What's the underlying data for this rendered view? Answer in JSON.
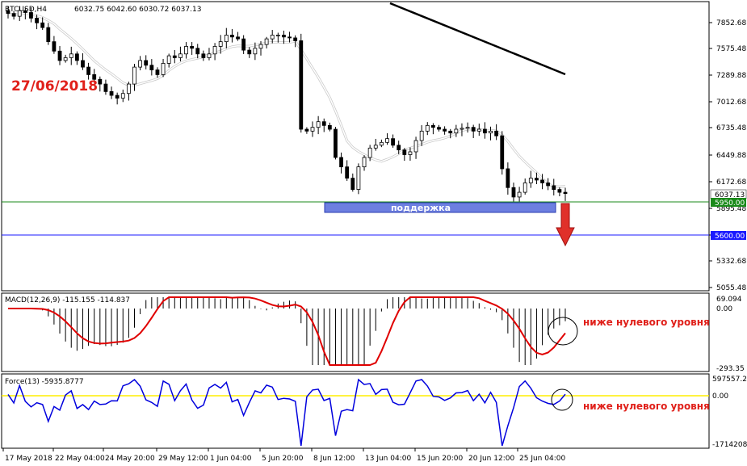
{
  "chart_data": [
    {
      "type": "candlestick",
      "symbol": "BTCUSD,H4",
      "ohlc_readout": "6032.75 6042.60 6030.72 6037.13",
      "date_label": "27/06/2018",
      "y_ticks": [
        "7852.68",
        "7575.48",
        "7289.88",
        "7012.68",
        "6735.48",
        "6449.88",
        "6172.68",
        "5895.48",
        "5600.00",
        "5332.68",
        "5055.48"
      ],
      "price_tags": [
        "6037.13",
        "5950.00",
        "5600.00"
      ],
      "support_label": "поддержка",
      "support_level": 5950,
      "target_level": 5600,
      "x_ticks": [
        "17 May 2018",
        "22 May 04:00",
        "24 May 20:00",
        "29 May 12:00",
        "1 Jun 04:00",
        "5 Jun 20:00",
        "8 Jun 12:00",
        "13 Jun 04:00",
        "15 Jun 20:00",
        "20 Jun 12:00",
        "25 Jun 04:00"
      ],
      "closes": [
        7950,
        7920,
        7980,
        7960,
        7900,
        7850,
        7800,
        7650,
        7550,
        7450,
        7480,
        7520,
        7450,
        7380,
        7300,
        7250,
        7200,
        7120,
        7080,
        7050,
        7100,
        7200,
        7380,
        7450,
        7400,
        7350,
        7300,
        7420,
        7500,
        7480,
        7520,
        7600,
        7580,
        7520,
        7480,
        7520,
        7600,
        7650,
        7720,
        7700,
        7680,
        7560,
        7520,
        7580,
        7620,
        7680,
        7720,
        7720,
        7700,
        7690,
        7660,
        6720,
        6700,
        6740,
        6800,
        6760,
        6720,
        6420,
        6320,
        6200,
        6080,
        6320,
        6420,
        6520,
        6550,
        6580,
        6620,
        6550,
        6500,
        6450,
        6480,
        6600,
        6700,
        6760,
        6740,
        6720,
        6700,
        6680,
        6720,
        6730,
        6740,
        6700,
        6720,
        6680,
        6700,
        6650,
        6300,
        6100,
        6000,
        6050,
        6150,
        6200,
        6180,
        6150,
        6120,
        6080,
        6050,
        6037
      ]
    },
    {
      "type": "macd",
      "label": "MACD(12,26,9) -115.155 -114.837",
      "y_ticks": [
        "69.094",
        "0.00",
        "-293.35"
      ],
      "annotation": "ниже нулевого уровня"
    },
    {
      "type": "force",
      "label": "Force(13) -5935.8777",
      "y_ticks": [
        "597557.2",
        "0.00",
        "-1714208"
      ],
      "annotation": "ниже нулевого уровня"
    }
  ]
}
